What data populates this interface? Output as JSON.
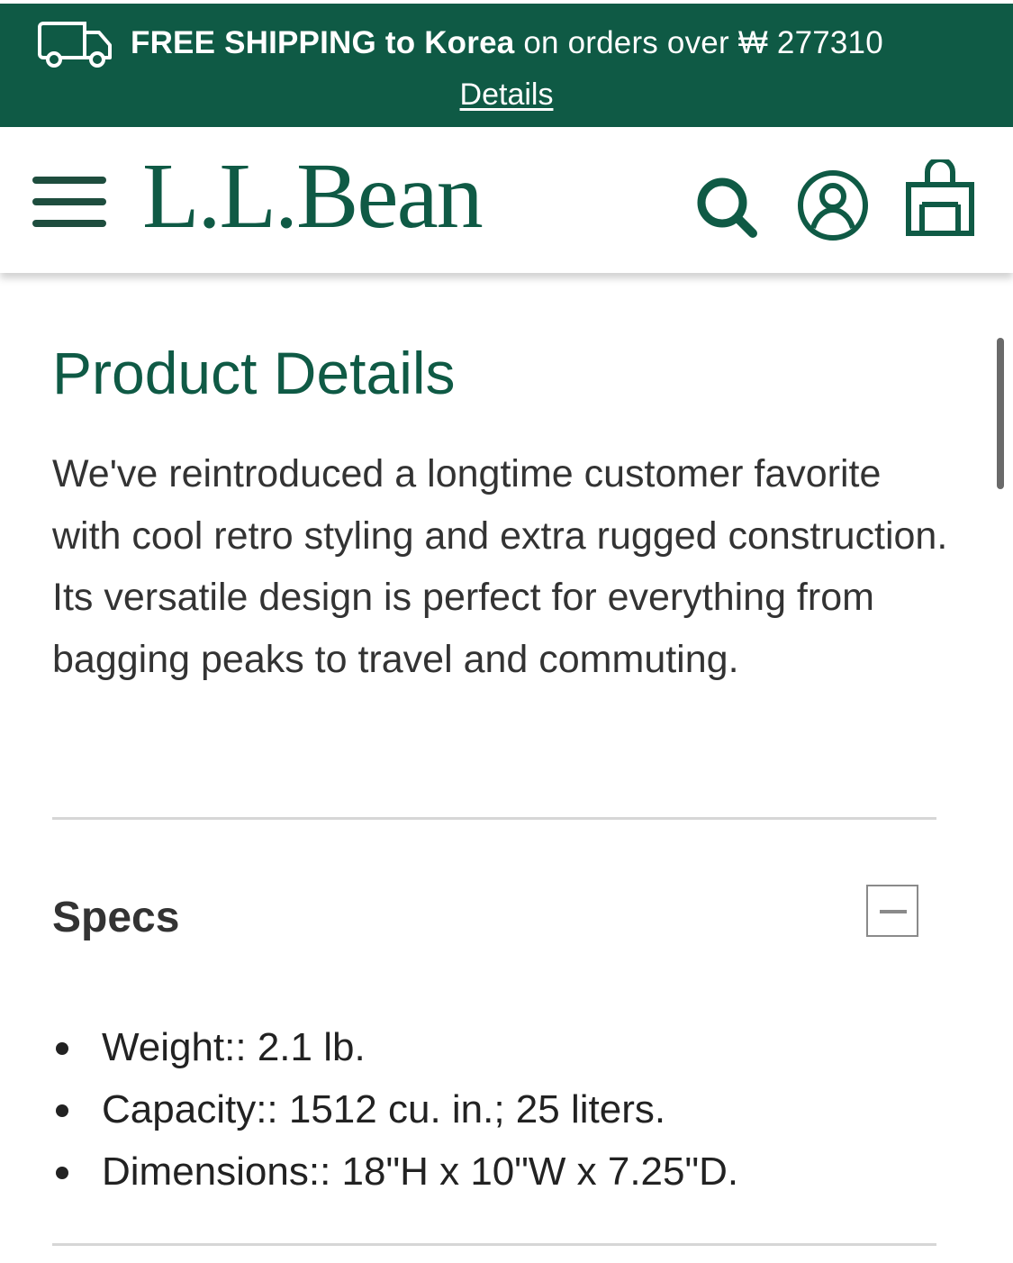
{
  "promo": {
    "bold_text": "FREE SHIPPING to Korea",
    "text": " on orders over ₩ 277310",
    "details_link": "Details",
    "icon": "truck-icon"
  },
  "header": {
    "logo": "L.L.Bean",
    "icons": [
      "menu-icon",
      "search-icon",
      "account-icon",
      "bag-icon"
    ],
    "brand_color": "#0f5a45"
  },
  "product": {
    "title": "Product Details",
    "description": "We've reintroduced a longtime customer favorite with cool retro styling and extra rugged construction. Its versatile design is perfect for everything from bagging peaks to travel and commuting."
  },
  "specs": {
    "heading": "Specs",
    "toggle_icon": "minus-icon",
    "items": [
      "Weight:: 2.1 lb.",
      "Capacity:: 1512 cu. in.; 25 liters.",
      "Dimensions:: 18\"H x 10\"W x 7.25\"D."
    ]
  }
}
